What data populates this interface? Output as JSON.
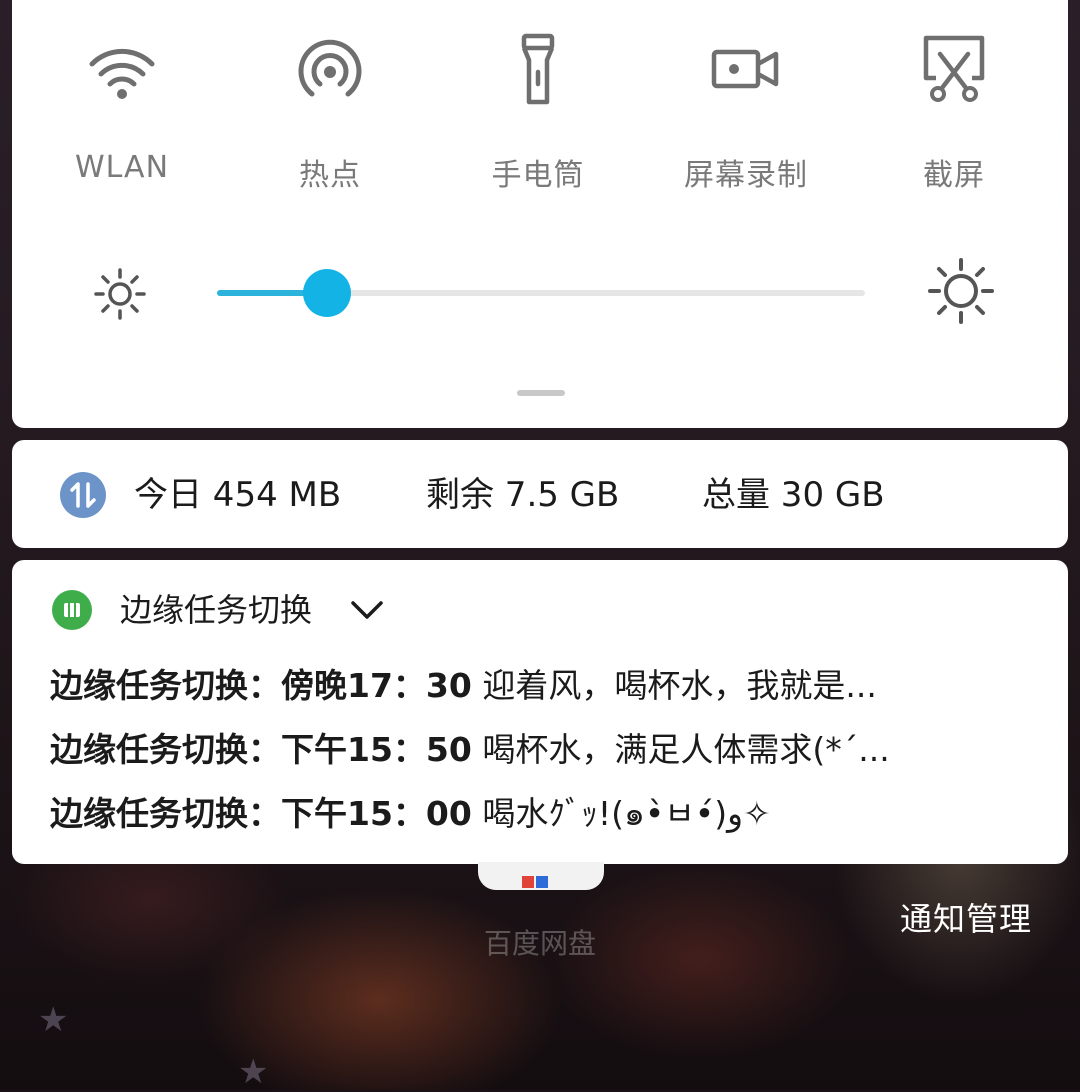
{
  "quick_settings": {
    "tiles": [
      {
        "label": "WLAN",
        "icon": "wifi-icon"
      },
      {
        "label": "热点",
        "icon": "hotspot-icon"
      },
      {
        "label": "手电筒",
        "icon": "flashlight-icon"
      },
      {
        "label": "屏幕录制",
        "icon": "screen-record-icon"
      },
      {
        "label": "截屏",
        "icon": "screenshot-icon"
      }
    ],
    "brightness": {
      "level": 0.17,
      "accent": "#14b3e6"
    }
  },
  "data_usage": {
    "today": "今日 454 MB",
    "remaining": "剩余 7.5 GB",
    "total": "总量 30 GB"
  },
  "notification": {
    "app_name": "边缘任务切换",
    "messages": [
      {
        "prefix": "边缘任务切换：傍晚17：30",
        "text": " 迎着风，喝杯水，我就是..."
      },
      {
        "prefix": "边缘任务切换：下午15：50",
        "text": " 喝杯水，满足人体需求(*´..."
      },
      {
        "prefix": "边缘任务切换：下午15：00",
        "text": " 喝水ｸﾞｯ!(๑•̀ㅂ•́)و✧"
      }
    ]
  },
  "background": {
    "app_label": "百度网盘",
    "notification_manage": "通知管理"
  }
}
